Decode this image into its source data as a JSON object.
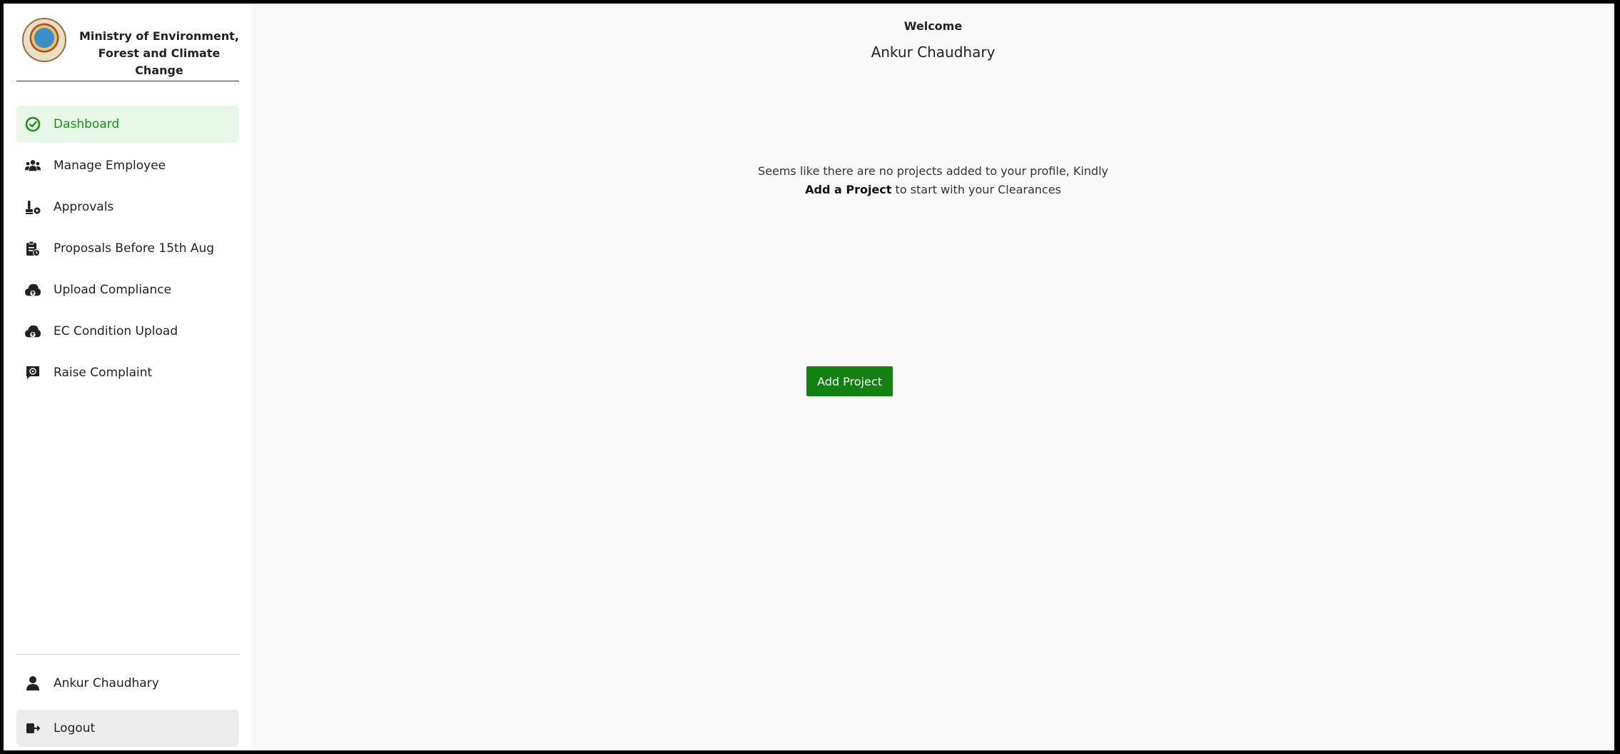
{
  "brand": {
    "line1": "Ministry of Environment,",
    "line2": "Forest and Climate Change"
  },
  "nav": {
    "items": [
      {
        "label": "Dashboard",
        "icon": "dashboard-icon",
        "active": true
      },
      {
        "label": "Manage Employee",
        "icon": "users-icon"
      },
      {
        "label": "Approvals",
        "icon": "stamp-icon"
      },
      {
        "label": "Proposals Before 15th Aug",
        "icon": "clipboard-icon"
      },
      {
        "label": "Upload Compliance",
        "icon": "cloud-upload-icon"
      },
      {
        "label": "EC Condition Upload",
        "icon": "cloud-upload-icon"
      },
      {
        "label": "Raise Complaint",
        "icon": "comment-icon"
      }
    ]
  },
  "user": {
    "name": "Ankur Chaudhary",
    "icon": "user-icon"
  },
  "logout": {
    "label": "Logout",
    "icon": "logout-icon"
  },
  "main": {
    "welcome": "Welcome",
    "username": "Ankur Chaudhary",
    "message_line1": "Seems like there are no projects added to your profile, Kindly",
    "message_bold": "Add a Project",
    "message_rest": " to start with your Clearances",
    "add_button": "Add Project"
  },
  "colors": {
    "accent": "#128012",
    "active_bg": "#e7f7e7",
    "active_text": "#1a8d1a"
  }
}
